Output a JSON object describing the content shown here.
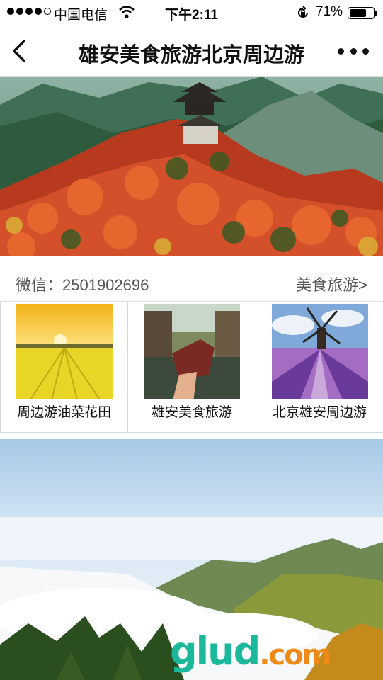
{
  "status_bar": {
    "carrier": "中国电信",
    "time": "下午2:11",
    "battery_percent": "71%",
    "battery_level": 0.71
  },
  "nav": {
    "title": "雄安美食旅游北京周边游"
  },
  "info": {
    "wechat": "微信：2501902696",
    "link": "美食旅游>"
  },
  "grid": {
    "items": [
      {
        "caption": "周边游油菜花田"
      },
      {
        "caption": "雄安美食旅游"
      },
      {
        "caption": "北京雄安周边游"
      }
    ]
  },
  "watermark": {
    "main": "glud",
    "suffix": ".com"
  },
  "colors": {
    "watermark_green": "#1cb89b",
    "watermark_orange": "#ef8a17"
  }
}
